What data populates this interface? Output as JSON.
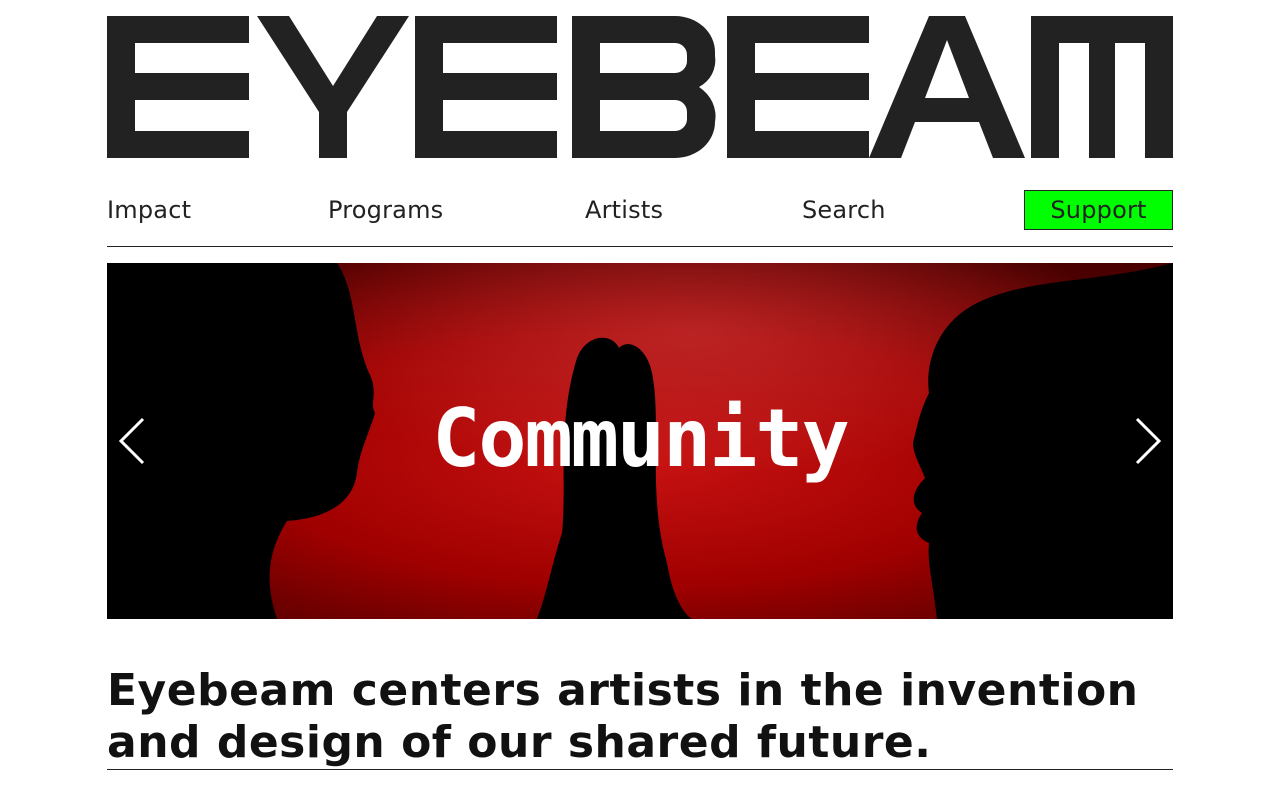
{
  "brand": {
    "logo_text": "EYEBEAM",
    "logo_color": "#222222"
  },
  "nav": {
    "items": [
      {
        "label": "Impact"
      },
      {
        "label": "Programs"
      },
      {
        "label": "Artists"
      },
      {
        "label": "Search"
      }
    ],
    "support_label": "Support",
    "support_color": "#00ff00"
  },
  "hero": {
    "title": "Community",
    "prev_icon": "chevron-left-icon",
    "next_icon": "chevron-right-icon",
    "accent": "#b00000"
  },
  "tagline": "Eyebeam centers artists in the invention and design of our shared future."
}
